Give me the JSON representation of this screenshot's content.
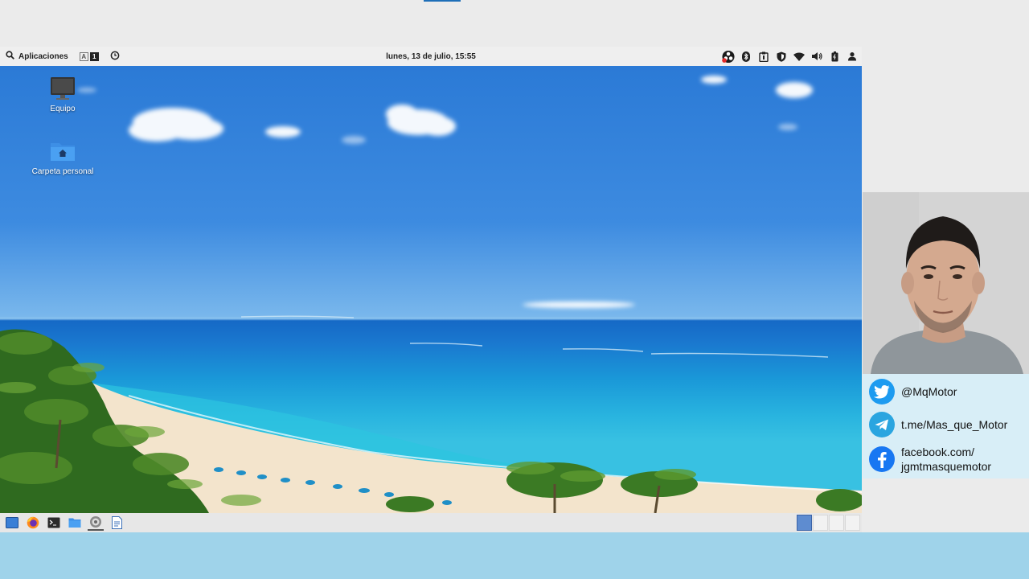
{
  "top_panel": {
    "applications_label": "Aplicaciones",
    "workspace_a": "A",
    "workspace_1": "1",
    "datetime": "lunes, 13 de julio, 15:55"
  },
  "desktop": {
    "icons": [
      {
        "label": "Equipo",
        "icon": "monitor-icon"
      },
      {
        "label": "Carpeta personal",
        "icon": "home-folder-icon"
      }
    ]
  },
  "taskbar": {
    "launchers": [
      "desktop-icon",
      "firefox-icon",
      "terminal-icon",
      "file-manager-icon",
      "settings-icon",
      "text-editor-icon"
    ],
    "workspaces": 4,
    "active_workspace": 1
  },
  "socials": {
    "twitter": "@MqMotor",
    "telegram": "t.me/Mas_que_Motor",
    "facebook_line1": "facebook.com/",
    "facebook_line2": "jgmtmasquemotor"
  },
  "colors": {
    "twitter": "#1d9bf0",
    "telegram": "#2aa5e0",
    "facebook": "#1877f2",
    "socials_bg": "#d8eef7",
    "frame_bottom": "#9fd3ea"
  }
}
